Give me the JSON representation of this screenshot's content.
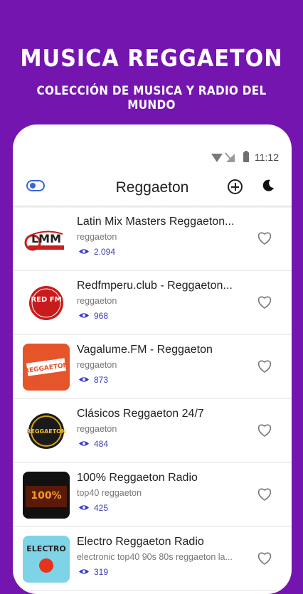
{
  "promo": {
    "title": "MUSICA REGGAETON",
    "subtitle": "COLECCIÓN DE MUSICA Y RADIO DEL MUNDO"
  },
  "status": {
    "time": "11:12"
  },
  "appbar": {
    "title": "Reggaeton"
  },
  "stations": [
    {
      "title": "Latin Mix Masters Reggaeton...",
      "genre": "reggaeton",
      "views": "2.094",
      "logo_text": "LMM"
    },
    {
      "title": "Redfmperu.club - Reggaeton...",
      "genre": "reggaeton",
      "views": "968",
      "logo_text": "RED FM"
    },
    {
      "title": "Vagalume.FM - Reggaeton",
      "genre": "reggaeton",
      "views": "873",
      "logo_text": "¡REGGAETON!"
    },
    {
      "title": "Clásicos Reggaeton 24/7",
      "genre": "reggaeton",
      "views": "484",
      "logo_text": "REGGAETON"
    },
    {
      "title": "100% Reggaeton Radio",
      "genre": "top40 reggaeton",
      "views": "425",
      "logo_text": "100%"
    },
    {
      "title": "Electro Reggaeton Radio",
      "genre": "electronic top40 90s 80s reggaeton la...",
      "views": "319",
      "logo_text": "ELECTRO"
    }
  ],
  "colors": {
    "brand": "#7415b0",
    "accent": "#3b3bbf"
  }
}
